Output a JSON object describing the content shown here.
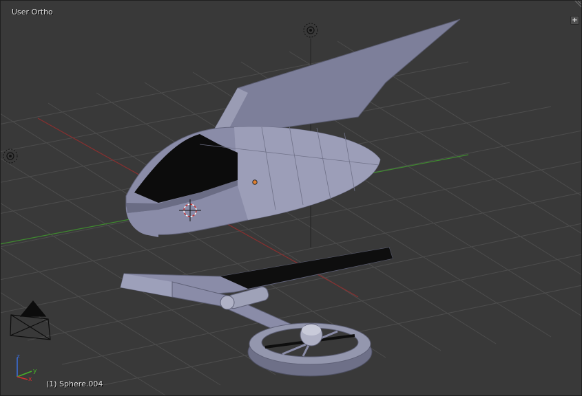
{
  "viewport": {
    "view_label": "User Ortho",
    "object_label": "(1) Sphere.004",
    "toolshelf_toggle": "+",
    "axes": {
      "x": "x",
      "y": "y",
      "z": "z"
    }
  },
  "colors": {
    "background": "#393939",
    "grid": "#505050",
    "x_axis": "#8a2f2f",
    "y_axis": "#3f8a2f",
    "mesh": "#8a8ca8",
    "mesh_dark": "#5e6076",
    "selection_origin": "#e08030"
  },
  "icons": [
    "lamp-icon",
    "camera-icon",
    "3d-cursor-icon",
    "origin-dot-icon",
    "axis-gizmo-icon",
    "add-panel-icon",
    "corner-grip-icon"
  ]
}
